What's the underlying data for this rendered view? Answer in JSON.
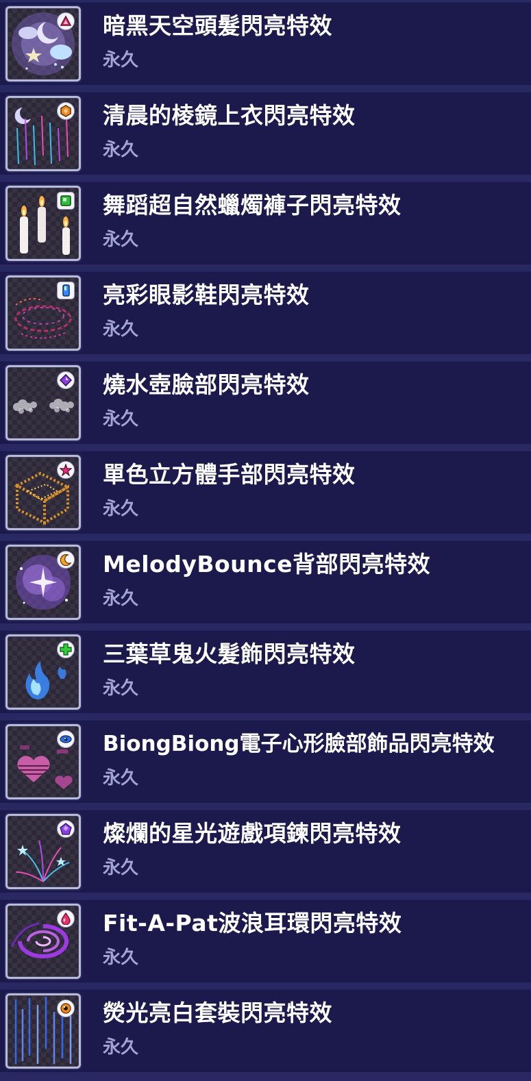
{
  "items": [
    {
      "title": "暗黑天空頭髮閃亮特效",
      "duration": "永久",
      "icon": "dark-sky-hair-icon",
      "badge": "triangle-gem-icon"
    },
    {
      "title": "清晨的棱鏡上衣閃亮特效",
      "duration": "永久",
      "icon": "prism-top-icon",
      "badge": "hexagon-gem-icon"
    },
    {
      "title": "舞蹈超自然蠟燭褲子閃亮特效",
      "duration": "永久",
      "icon": "candles-pants-icon",
      "badge": "square-gem-icon"
    },
    {
      "title": "亮彩眼影鞋閃亮特效",
      "duration": "永久",
      "icon": "eyeshadow-shoes-icon",
      "badge": "rectangle-gem-icon"
    },
    {
      "title": "燒水壺臉部閃亮特效",
      "duration": "永久",
      "icon": "kettle-face-icon",
      "badge": "diamond-gem-icon"
    },
    {
      "title": "單色立方體手部閃亮特效",
      "duration": "永久",
      "icon": "cube-hands-icon",
      "badge": "star-gem-icon"
    },
    {
      "title": "MelodyBounce背部閃亮特效",
      "duration": "永久",
      "icon": "melody-bounce-back-icon",
      "badge": "crescent-moon-icon"
    },
    {
      "title": "三葉草鬼火髮飾閃亮特效",
      "duration": "永久",
      "icon": "clover-wisp-hair-accessory-icon",
      "badge": "clover-gem-icon"
    },
    {
      "title": "BiongBiong電子心形臉部飾品閃亮特效",
      "duration": "永久",
      "icon": "digital-heart-face-icon",
      "badge": "eye-gem-icon"
    },
    {
      "title": "燦爛的星光遊戲項鍊閃亮特效",
      "duration": "永久",
      "icon": "starlight-necklace-icon",
      "badge": "pentagon-gem-icon"
    },
    {
      "title": "Fit-A-Pat波浪耳環閃亮特效",
      "duration": "永久",
      "icon": "wave-earrings-icon",
      "badge": "droplet-gem-icon"
    },
    {
      "title": "熒光亮白套裝閃亮特效",
      "duration": "永久",
      "icon": "fluorescent-outfit-icon",
      "badge": "orb-gem-icon"
    }
  ]
}
